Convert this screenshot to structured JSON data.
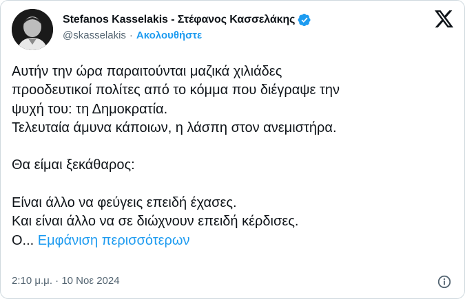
{
  "author": {
    "display_name": "Stefanos Kasselakis - Στέφανος Κασσελάκης",
    "handle": "@skasselakis",
    "separator": "·",
    "follow_label": "Ακολουθήστε",
    "verified": true
  },
  "platform_logo": "x-logo",
  "post": {
    "lines": [
      "Αυτήν την ώρα παραιτούνται μαζικά χιλιάδες",
      "προοδευτικοί πολίτες από το κόμμα που διέγραψε την",
      "ψυχή του: τη Δημοκρατία.",
      "Τελευταία άμυνα κάποιων, η λάσπη στον ανεμιστήρα.",
      "",
      "Θα είμαι ξεκάθαρος:",
      "",
      "Είναι άλλο να φεύγεις επειδή έχασες.",
      "Και είναι άλλο να σε διώχνουν επειδή κέρδισες."
    ],
    "truncated_text": "Ο...",
    "show_more_label": "Εμφάνιση περισσότερων"
  },
  "meta": {
    "time": "2:10 μ.μ.",
    "separator": "·",
    "date": "10 Νοε 2024"
  },
  "icons": {
    "verified": "verified-badge-icon",
    "info": "info-icon"
  },
  "colors": {
    "accent": "#1d9bf0",
    "text": "#0f1419",
    "secondary": "#536471"
  }
}
